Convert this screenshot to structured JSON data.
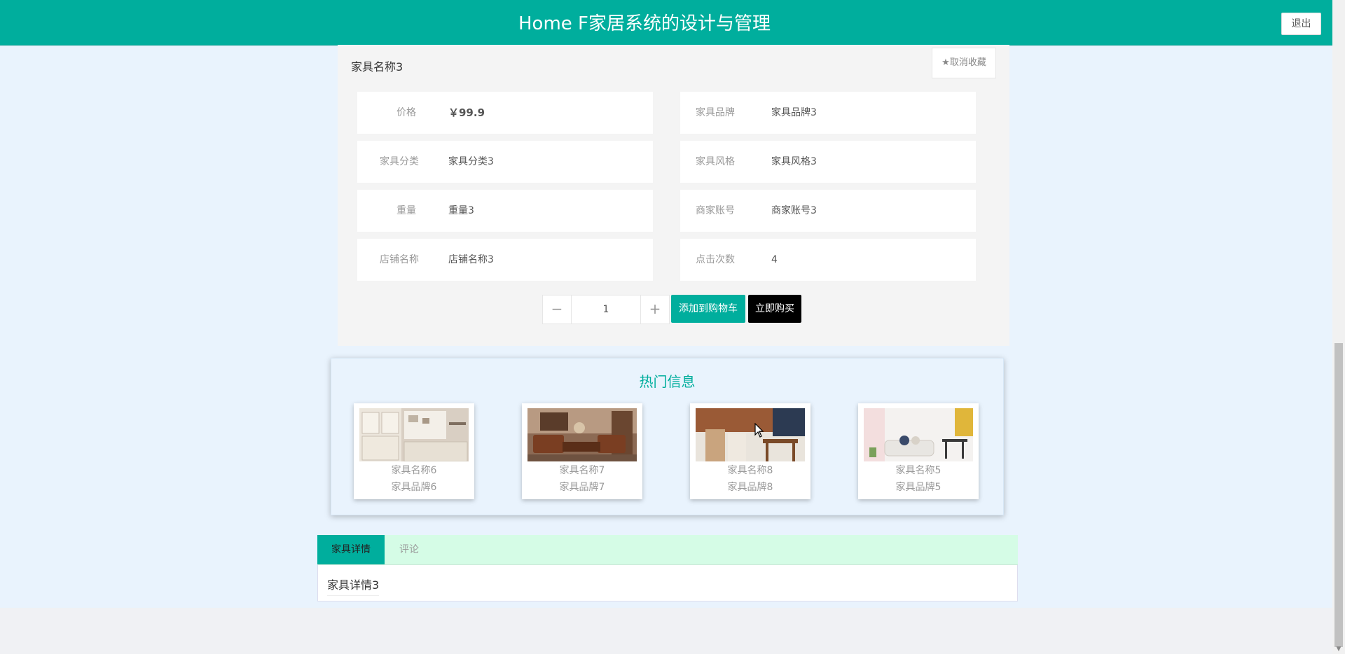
{
  "header": {
    "title": "Home F家居系统的设计与管理",
    "logout_label": "退出"
  },
  "product": {
    "name": "家具名称3",
    "favorite_label": "★取消收藏",
    "fields": [
      {
        "label": "价格",
        "value": "￥99.9"
      },
      {
        "label": "家具品牌",
        "value": "家具品牌3"
      },
      {
        "label": "家具分类",
        "value": "家具分类3"
      },
      {
        "label": "家具风格",
        "value": "家具风格3"
      },
      {
        "label": "重量",
        "value": "重量3"
      },
      {
        "label": "商家账号",
        "value": "商家账号3"
      },
      {
        "label": "店铺名称",
        "value": "店铺名称3"
      },
      {
        "label": "点击次数",
        "value": "4"
      }
    ]
  },
  "purchase": {
    "minus": "−",
    "plus": "+",
    "quantity": "1",
    "add_to_cart_label": "添加到购物车",
    "buy_now_label": "立即购买"
  },
  "hot": {
    "title": "热门信息",
    "items": [
      {
        "name": "家具名称6",
        "brand": "家具品牌6"
      },
      {
        "name": "家具名称7",
        "brand": "家具品牌7"
      },
      {
        "name": "家具名称8",
        "brand": "家具品牌8"
      },
      {
        "name": "家具名称5",
        "brand": "家具品牌5"
      }
    ]
  },
  "tabs": {
    "items": [
      {
        "label": "家具详情"
      },
      {
        "label": "评论"
      }
    ],
    "content": "家具详情3"
  },
  "colors": {
    "accent": "#00ae9d",
    "page_bg": "#e9f3fd",
    "tab_bar": "#d5fce6"
  }
}
